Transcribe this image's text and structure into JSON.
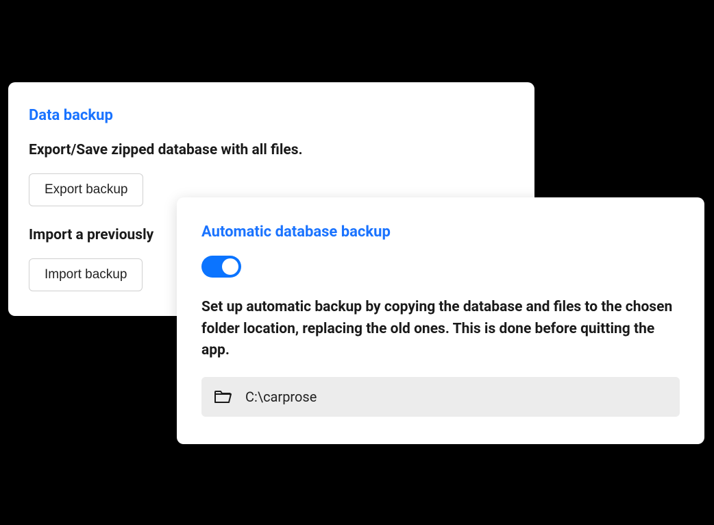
{
  "data_backup": {
    "title": "Data backup",
    "export_heading": "Export/Save zipped database with all files.",
    "export_button": "Export backup",
    "import_heading": "Import a previously",
    "import_button": "Import backup"
  },
  "auto_backup": {
    "title": "Automatic database backup",
    "enabled": true,
    "description": "Set up automatic backup by copying the database and files to the chosen folder location, replacing the old ones. This is done before quitting the app.",
    "path": "C:\\carprose"
  }
}
